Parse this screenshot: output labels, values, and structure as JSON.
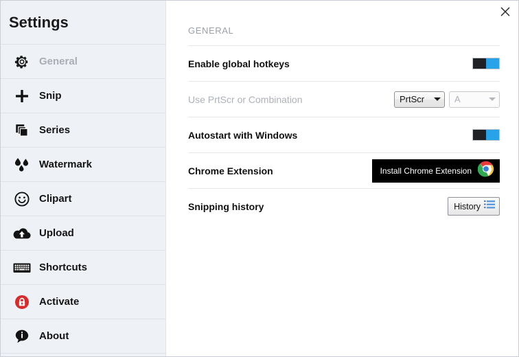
{
  "window": {
    "title": "Settings",
    "close_icon": "close-icon"
  },
  "sidebar": {
    "title": "Settings",
    "items": [
      {
        "label": "General",
        "icon": "gear-icon",
        "active": true
      },
      {
        "label": "Snip",
        "icon": "plus-icon",
        "active": false
      },
      {
        "label": "Series",
        "icon": "copy-stack-icon",
        "active": false
      },
      {
        "label": "Watermark",
        "icon": "droplets-icon",
        "active": false
      },
      {
        "label": "Clipart",
        "icon": "smiley-icon",
        "active": false
      },
      {
        "label": "Upload",
        "icon": "cloud-upload-icon",
        "active": false
      },
      {
        "label": "Shortcuts",
        "icon": "keyboard-icon",
        "active": false
      },
      {
        "label": "Activate",
        "icon": "lock-icon",
        "active": false
      },
      {
        "label": "About",
        "icon": "info-bubble-icon",
        "active": false
      }
    ]
  },
  "main": {
    "section_title": "GENERAL",
    "rows": [
      {
        "label": "Enable global hotkeys",
        "control": "toggle",
        "toggle_on": true,
        "disabled": false
      },
      {
        "label": "Use PrtScr or Combination",
        "control": "selects",
        "disabled": true,
        "select_primary": "PrtScr",
        "select_secondary": "A"
      },
      {
        "label": "Autostart with Windows",
        "control": "toggle",
        "toggle_on": true,
        "disabled": false
      },
      {
        "label": "Chrome Extension",
        "control": "chrome-button",
        "disabled": false,
        "button_label": "Install Chrome Extension",
        "button_icon": "chrome-logo-icon"
      },
      {
        "label": "Snipping history",
        "control": "history-button",
        "disabled": false,
        "button_label": "History",
        "button_icon": "list-lines-icon"
      }
    ]
  },
  "colors": {
    "sidebar_bg": "#eef1f6",
    "toggle_on": "#29a3e8",
    "toggle_knob": "#202124",
    "accent_red": "#d92b2b",
    "chrome_button_bg": "#000000"
  }
}
